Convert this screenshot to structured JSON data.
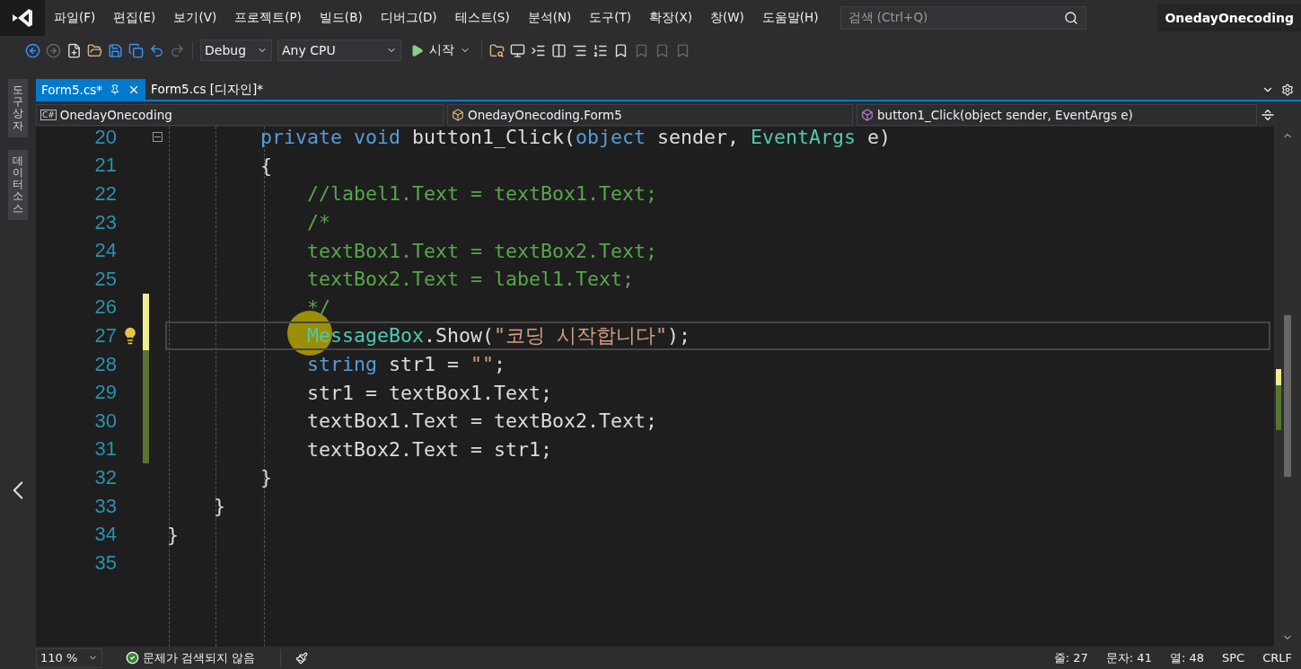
{
  "menu_bar": {
    "items": [
      "파일(F)",
      "편집(E)",
      "보기(V)",
      "프로젝트(P)",
      "빌드(B)",
      "디버그(D)",
      "테스트(S)",
      "분석(N)",
      "도구(T)",
      "확장(X)",
      "창(W)",
      "도움말(H)"
    ],
    "search": {
      "placeholder": "검색 (Ctrl+Q)"
    },
    "account": "OnedayOnecoding"
  },
  "toolbar": {
    "configuration": "Debug",
    "platform": "Any CPU",
    "start": "시작"
  },
  "side_tabs": [
    "도구 상자",
    "데이터 소스"
  ],
  "document_tabs": [
    {
      "label": "Form5.cs*",
      "selected": true
    },
    {
      "label": "Form5.cs [디자인]*",
      "selected": false
    }
  ],
  "navigation_bar": {
    "project_badge": "C#",
    "project": "OnedayOnecoding",
    "class": "OnedayOnecoding.Form5",
    "member": "button1_Click(object sender, EventArgs e)"
  },
  "editor": {
    "lines": [
      {
        "number": "20",
        "selected": false,
        "fold": true,
        "unsaved_change": false,
        "saved_change": false,
        "tokens": [
          {
            "kind": "keyword",
            "text": "        private void "
          },
          {
            "kind": "plain",
            "text": "button1_Click("
          },
          {
            "kind": "keyword",
            "text": "object"
          },
          {
            "kind": "plain",
            "text": " sender, "
          },
          {
            "kind": "type",
            "text": "EventArgs"
          },
          {
            "kind": "plain",
            "text": " e)"
          }
        ]
      },
      {
        "number": "21",
        "selected": false,
        "fold": false,
        "unsaved_change": false,
        "saved_change": false,
        "tokens": [
          {
            "kind": "plain",
            "text": "        {"
          }
        ]
      },
      {
        "number": "22",
        "selected": false,
        "fold": false,
        "unsaved_change": false,
        "saved_change": false,
        "tokens": [
          {
            "kind": "comment",
            "text": "            //label1.Text = textBox1.Text;"
          }
        ]
      },
      {
        "number": "23",
        "selected": false,
        "fold": false,
        "unsaved_change": false,
        "saved_change": false,
        "tokens": [
          {
            "kind": "comment",
            "text": "            /*"
          }
        ]
      },
      {
        "number": "24",
        "selected": false,
        "fold": false,
        "unsaved_change": false,
        "saved_change": false,
        "tokens": [
          {
            "kind": "comment",
            "text": "            textBox1.Text = textBox2.Text;"
          }
        ]
      },
      {
        "number": "25",
        "selected": false,
        "fold": false,
        "unsaved_change": false,
        "saved_change": false,
        "tokens": [
          {
            "kind": "comment",
            "text": "            textBox2.Text = label1.Text;"
          }
        ]
      },
      {
        "number": "26",
        "selected": false,
        "fold": false,
        "unsaved_change": true,
        "saved_change": false,
        "tokens": [
          {
            "kind": "comment",
            "text": "            */"
          }
        ]
      },
      {
        "number": "27",
        "selected": true,
        "fold": false,
        "unsaved_change": true,
        "saved_change": false,
        "tokens": [
          {
            "kind": "type",
            "text": "            MessageBox"
          },
          {
            "kind": "plain",
            "text": ".Show("
          },
          {
            "kind": "string",
            "text": "\"코딩 시작합니다\""
          },
          {
            "kind": "plain",
            "text": ");"
          }
        ]
      },
      {
        "number": "28",
        "selected": false,
        "fold": false,
        "unsaved_change": false,
        "saved_change": true,
        "tokens": [
          {
            "kind": "keyword",
            "text": "            string"
          },
          {
            "kind": "plain",
            "text": " str1 = "
          },
          {
            "kind": "string",
            "text": "\"\""
          },
          {
            "kind": "plain",
            "text": ";"
          }
        ]
      },
      {
        "number": "29",
        "selected": false,
        "fold": false,
        "unsaved_change": false,
        "saved_change": true,
        "tokens": [
          {
            "kind": "plain",
            "text": "            str1 = textBox1.Text;"
          }
        ]
      },
      {
        "number": "30",
        "selected": false,
        "fold": false,
        "unsaved_change": false,
        "saved_change": true,
        "tokens": [
          {
            "kind": "plain",
            "text": "            textBox1.Text = textBox2.Text;"
          }
        ]
      },
      {
        "number": "31",
        "selected": false,
        "fold": false,
        "unsaved_change": false,
        "saved_change": true,
        "tokens": [
          {
            "kind": "plain",
            "text": "            textBox2.Text = str1;"
          }
        ]
      },
      {
        "number": "32",
        "selected": false,
        "fold": false,
        "unsaved_change": false,
        "saved_change": false,
        "tokens": [
          {
            "kind": "plain",
            "text": "        }"
          }
        ]
      },
      {
        "number": "33",
        "selected": false,
        "fold": false,
        "unsaved_change": false,
        "saved_change": false,
        "tokens": [
          {
            "kind": "plain",
            "text": "    }"
          }
        ]
      },
      {
        "number": "34",
        "selected": false,
        "fold": false,
        "unsaved_change": false,
        "saved_change": false,
        "tokens": [
          {
            "kind": "plain",
            "text": "}"
          }
        ]
      },
      {
        "number": "35",
        "selected": false,
        "fold": false,
        "unsaved_change": false,
        "saved_change": false
      }
    ]
  },
  "status_bar": {
    "zoom": "110 %",
    "issues": "문제가 검색되지 않음",
    "line": "줄: 27",
    "char": "문자: 41",
    "column": "열: 48",
    "whitespace": "SPC",
    "line_ending": "CRLF"
  }
}
